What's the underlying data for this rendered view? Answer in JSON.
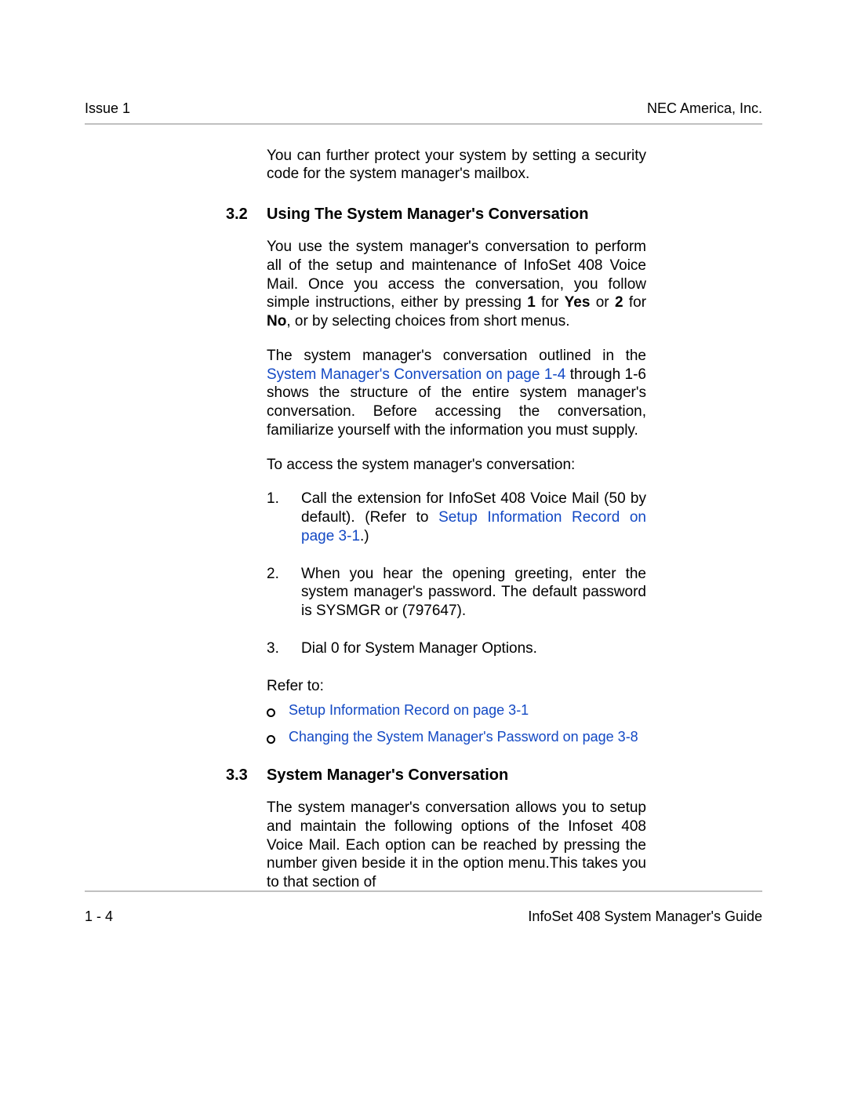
{
  "header": {
    "left": "Issue 1",
    "right": "NEC America, Inc."
  },
  "intro_para": "You can further protect your system by setting a security code for the system manager's mailbox.",
  "s32": {
    "num": "3.2",
    "title": "Using The System Manager's Conversation",
    "p1_a": "You use the system manager's conversation to perform all of the setup and maintenance of InfoSet 408 Voice Mail. Once you access the conversation, you follow simple instructions, either by pressing ",
    "p1_b1": "1",
    "p1_c": " for ",
    "p1_b2": "Yes",
    "p1_d": " or ",
    "p1_b3": "2",
    "p1_e": " for ",
    "p1_b4": "No",
    "p1_f": ", or by selecting choices from short menus.",
    "p2_a": "The system manager's conversation outlined in the ",
    "p2_link": "System Manager's Conversation on page 1-4",
    "p2_b": " through 1-6 shows the structure of the entire system manager's conversation. Before accessing the conversation, familiarize yourself with the information you must supply.",
    "p3": "To access the system manager's conversation:",
    "steps": [
      {
        "n": "1.",
        "text_a": "Call the extension for InfoSet 408 Voice Mail (50 by default). (Refer to ",
        "link": "Setup Information Record on page 3-1",
        "text_b": ".)"
      },
      {
        "n": "2.",
        "text_a": "When you hear the opening greeting, enter the system manager's password.  The default password is SYSMGR or (797647).",
        "link": "",
        "text_b": ""
      },
      {
        "n": "3.",
        "text_a": "Dial 0 for System Manager Options.",
        "link": "",
        "text_b": ""
      }
    ],
    "refer_label": "Refer to:",
    "refs": [
      "Setup Information Record on page 3-1",
      "Changing the System Manager's Password on page 3-8"
    ]
  },
  "s33": {
    "num": "3.3",
    "title": "System Manager's Conversation",
    "p1": "The system manager's conversation allows you to setup and maintain the following options of the Infoset 408 Voice Mail. Each option can be reached by pressing the number given beside it in the option menu.This takes you to that section of"
  },
  "footer": {
    "left": "1 - 4",
    "right": "InfoSet 408 System Manager's Guide"
  }
}
